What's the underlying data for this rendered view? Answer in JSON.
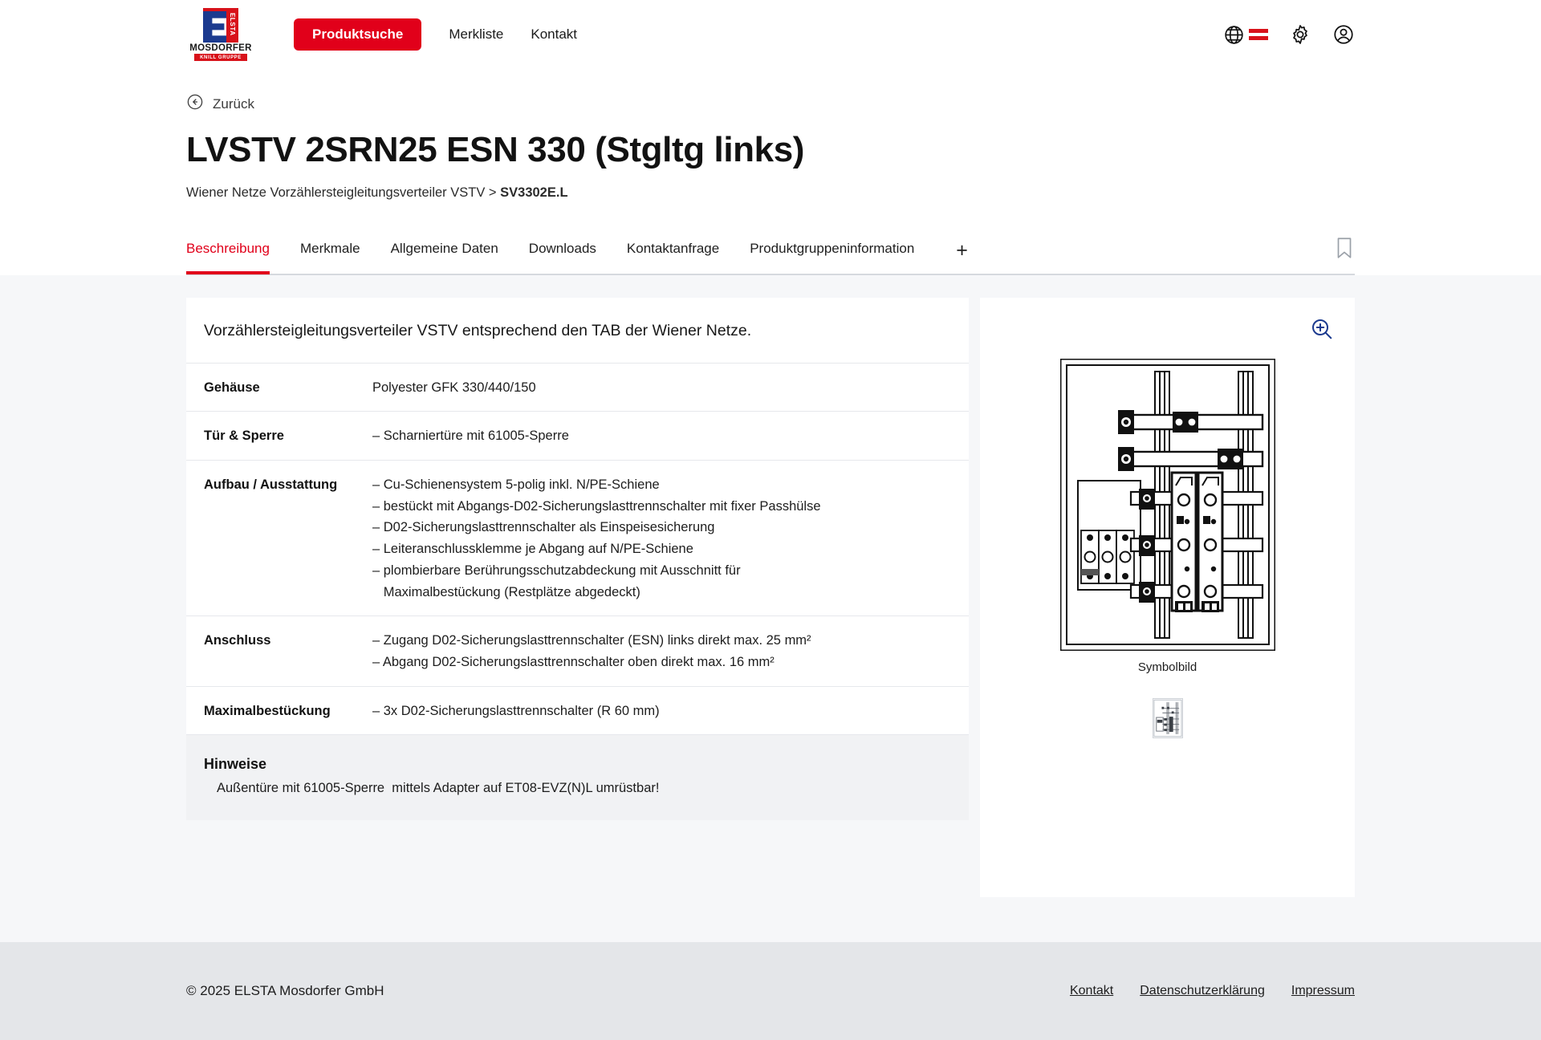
{
  "brand": {
    "mark_text": "ELSTA",
    "name": "MOSDORFER",
    "sub": "KNILL GRUPPE"
  },
  "header": {
    "nav": [
      {
        "label": "Produktsuche",
        "style": "pill",
        "name": "nav-produktsuche"
      },
      {
        "label": "Merkliste",
        "style": "link",
        "name": "nav-merkliste"
      },
      {
        "label": "Kontakt",
        "style": "link",
        "name": "nav-kontakt"
      }
    ],
    "icons": [
      "globe-icon",
      "austria-flag-icon",
      "gear-icon",
      "user-account-icon"
    ],
    "accent_color": "#e1001a"
  },
  "title_block": {
    "back_label": "Zurück",
    "title": "LVSTV 2SRN25 ESN 330 (Stgltg links)",
    "breadcrumb_path": "Wiener Netze Vorzählersteigleitungsverteiler VSTV > ",
    "breadcrumb_current": "SV3302E.L"
  },
  "tabs": {
    "items": [
      {
        "label": "Beschreibung",
        "active": true
      },
      {
        "label": "Merkmale",
        "active": false
      },
      {
        "label": "Allgemeine Daten",
        "active": false
      },
      {
        "label": "Downloads",
        "active": false
      },
      {
        "label": "Kontaktanfrage",
        "active": false
      },
      {
        "label": "Produktgruppeninformation",
        "active": false
      }
    ],
    "plus_glyph": "+",
    "bookmark_icon": "bookmark-icon"
  },
  "description": {
    "intro": "Vorzählersteigleitungsverteiler VSTV entsprechend den TAB der Wiener Netze.",
    "rows": [
      {
        "key": "Gehäuse",
        "lines": [
          "Polyester GFK 330/440/150"
        ]
      },
      {
        "key": "Tür & Sperre",
        "lines": [
          "– Scharniertüre mit 61005-Sperre"
        ]
      },
      {
        "key": "Aufbau / Ausstattung",
        "lines": [
          "– Cu-Schienensystem 5-polig inkl. N/PE-Schiene",
          "– bestückt mit Abgangs-D02-Sicherungslasttrennschalter mit fixer Passhülse",
          "– D02-Sicherungslasttrennschalter als Einspeisesicherung",
          "– Leiteranschlussklemme je Abgang auf N/PE-Schiene",
          "– plombierbare Berührungsschutzabdeckung mit Ausschnitt für",
          "   Maximalbestückung (Restplätze abgedeckt)"
        ]
      },
      {
        "key": "Anschluss",
        "lines": [
          "– Zugang D02-Sicherungslasttrennschalter (ESN) links direkt max. 25 mm²",
          "– Abgang D02-Sicherungslasttrennschalter oben direkt max. 16 mm²"
        ]
      },
      {
        "key": "Maximalbestückung",
        "lines": [
          "– 3x D02-Sicherungslasttrennschalter (R 60 mm)"
        ]
      }
    ],
    "hinweise_title": "Hinweise",
    "hinweise_text": "Außentüre mit 61005-Sperre  mittels Adapter auf ET08-EVZ(N)L umrüstbar!"
  },
  "media": {
    "zoom_icon": "zoom-in-icon",
    "caption": "Symbolbild",
    "thumbnail_name": "product-thumbnail",
    "hero_alt": "technical-drawing-distribution-board"
  },
  "footer": {
    "copyright": "© 2025 ELSTA Mosdorfer GmbH",
    "links": [
      "Kontakt",
      "Datenschutzerklärung",
      "Impressum"
    ]
  }
}
